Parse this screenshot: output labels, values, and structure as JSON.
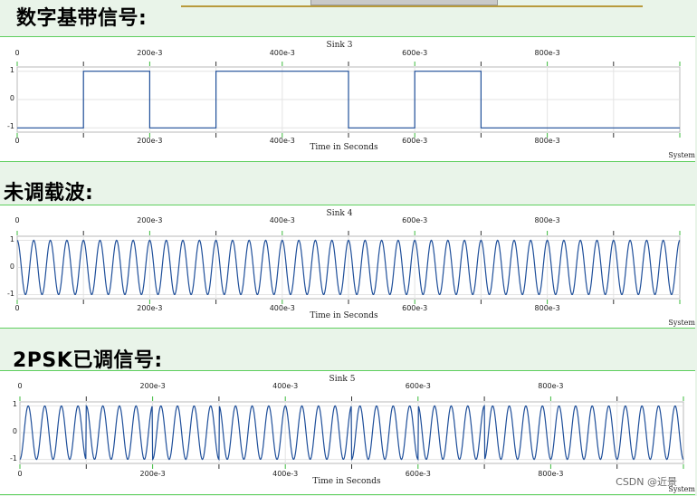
{
  "headings": {
    "baseband": "数字基带信号:",
    "carrier": "未调载波:",
    "psk": "2PSK已调信号:"
  },
  "watermark": "CSDN @近景",
  "system_label": "System",
  "chart_data": [
    {
      "type": "line",
      "title": "Sink 3",
      "xlabel": "Time in Seconds",
      "x_ticks": [
        "0",
        "200e-3",
        "400e-3",
        "600e-3",
        "800e-3"
      ],
      "y_ticks": [
        "1",
        "0",
        "-1"
      ],
      "xlim": [
        0,
        1
      ],
      "ylim": [
        -1.15,
        1.15
      ],
      "grid": true,
      "series": [
        {
          "signal": "nrz",
          "bits": [
            -1,
            1,
            -1,
            1,
            1,
            -1,
            1,
            -1,
            -1,
            -1
          ],
          "bit_duration": 0.1
        }
      ]
    },
    {
      "type": "line",
      "title": "Sink 4",
      "xlabel": "Time in Seconds",
      "x_ticks": [
        "0",
        "200e-3",
        "400e-3",
        "600e-3",
        "800e-3"
      ],
      "y_ticks": [
        "1",
        "0",
        "-1"
      ],
      "xlim": [
        0,
        1
      ],
      "ylim": [
        -1.15,
        1.15
      ],
      "grid": true,
      "series": [
        {
          "signal": "sine",
          "frequency": 40,
          "amplitude": 1
        }
      ]
    },
    {
      "type": "line",
      "title": "Sink 5",
      "xlabel": "Time in Seconds",
      "x_ticks": [
        "0",
        "200e-3",
        "400e-3",
        "600e-3",
        "800e-3"
      ],
      "y_ticks": [
        "1",
        "0",
        "-1"
      ],
      "xlim": [
        0,
        1
      ],
      "ylim": [
        -1.15,
        1.15
      ],
      "grid": true,
      "series": [
        {
          "signal": "psk",
          "frequency": 40,
          "amplitude": 1,
          "bits": [
            -1,
            1,
            -1,
            1,
            1,
            -1,
            1,
            -1,
            -1,
            -1
          ],
          "bit_duration": 0.1
        }
      ]
    }
  ]
}
